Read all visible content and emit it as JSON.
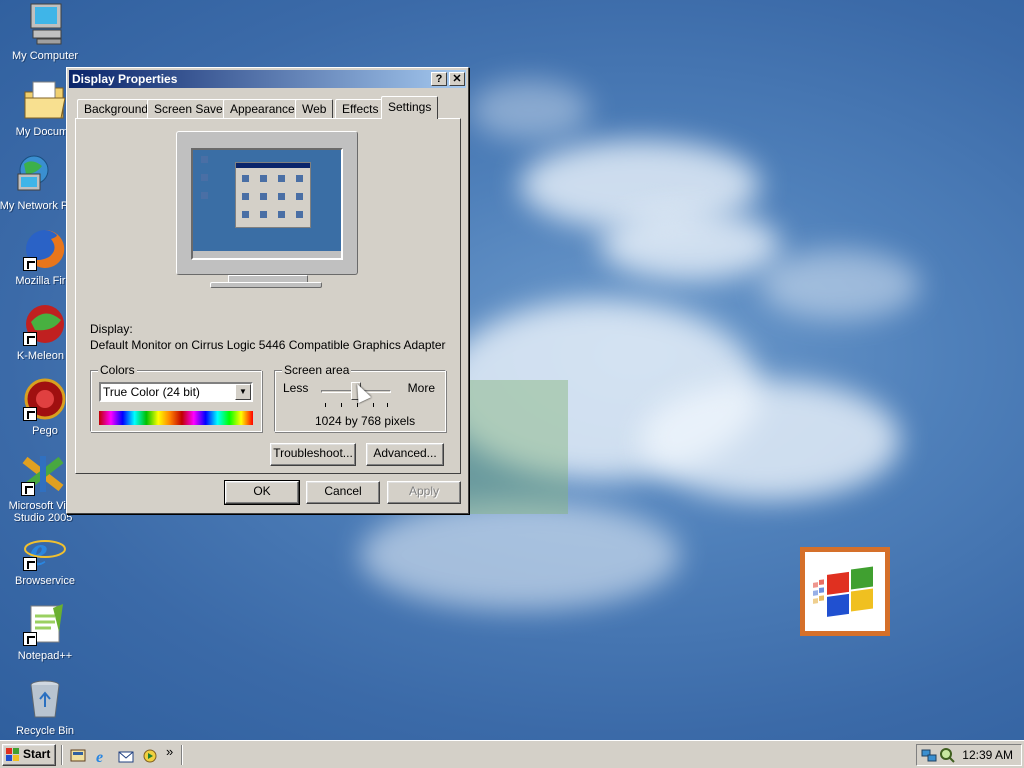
{
  "desktop": {
    "icons": [
      {
        "label": "My Computer",
        "icon": "my-computer-icon"
      },
      {
        "label": "My Docume",
        "icon": "my-documents-icon"
      },
      {
        "label": "My Network P",
        "icon": "my-network-places-icon"
      },
      {
        "label": "Mozilla Firef",
        "icon": "firefox-icon"
      },
      {
        "label": "K-Meleon 7",
        "icon": "k-meleon-icon"
      },
      {
        "label": "Pego",
        "icon": "pego-icon"
      },
      {
        "label": "Microsoft Visu",
        "label2": "Studio 2005",
        "icon": "visual-studio-icon"
      },
      {
        "label": "Browservice",
        "icon": "internet-explorer-icon"
      },
      {
        "label": "Notepad++",
        "icon": "notepad-plus-plus-icon"
      },
      {
        "label": "Recycle Bin",
        "icon": "recycle-bin-icon"
      }
    ]
  },
  "dialog": {
    "title": "Display Properties",
    "help_button": "?",
    "close_button": "✕",
    "tabs": [
      "Background",
      "Screen Saver",
      "Appearance",
      "Web",
      "Effects",
      "Settings"
    ],
    "active_tab": "Settings",
    "display_label": "Display:",
    "display_value": "Default Monitor on Cirrus Logic 5446 Compatible Graphics Adapter",
    "colors": {
      "title": "Colors",
      "selected": "True Color (24 bit)"
    },
    "screen_area": {
      "title": "Screen area",
      "less": "Less",
      "more": "More",
      "value": "1024 by 768 pixels",
      "slider_position": 0.5
    },
    "buttons": {
      "troubleshoot": "Troubleshoot...",
      "advanced": "Advanced...",
      "ok": "OK",
      "cancel": "Cancel",
      "apply": "Apply"
    }
  },
  "taskbar": {
    "start_label": "Start",
    "quicklaunch_more": "»",
    "clock": "12:39 AM"
  },
  "colors": {
    "desktop": "#3b6aa8",
    "titlebar_start": "#0a246a",
    "titlebar_end": "#a6caf0",
    "face": "#d4d0c8",
    "logo_border": "#d5702a"
  }
}
